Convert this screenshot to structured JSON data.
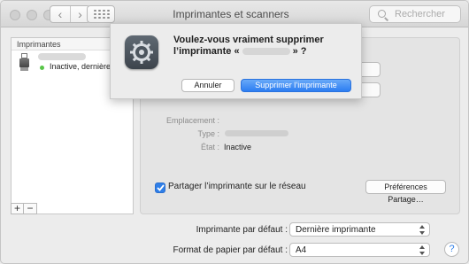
{
  "window": {
    "title": "Imprimantes et scanners",
    "search": {
      "placeholder": "Rechercher"
    },
    "nav": {
      "back": "‹",
      "forward": "›"
    }
  },
  "printers": {
    "header": "Imprimantes",
    "items": [
      {
        "name": "",
        "status": "Inactive, dernière u"
      }
    ],
    "add_label": "+",
    "remove_label": "−"
  },
  "details": {
    "location_label": "Emplacement :",
    "type_label": "Type :",
    "state_label": "État :",
    "state_value": "Inactive"
  },
  "share": {
    "checked": true,
    "label": "Partager l’imprimante sur le réseau",
    "prefs_button": "Préférences Partage…"
  },
  "defaults": {
    "printer_label": "Imprimante par défaut :",
    "printer_value": "Dernière imprimante",
    "paper_label": "Format de papier par défaut :",
    "paper_value": "A4"
  },
  "help_label": "?",
  "dialog": {
    "line1": "Voulez-vous vraiment supprimer",
    "line2_prefix": "l’imprimante «",
    "line2_suffix": "» ?",
    "cancel": "Annuler",
    "confirm": "Supprimer l’imprimante"
  },
  "colors": {
    "accent": "#2f7fe8",
    "status_green": "#58c548"
  }
}
